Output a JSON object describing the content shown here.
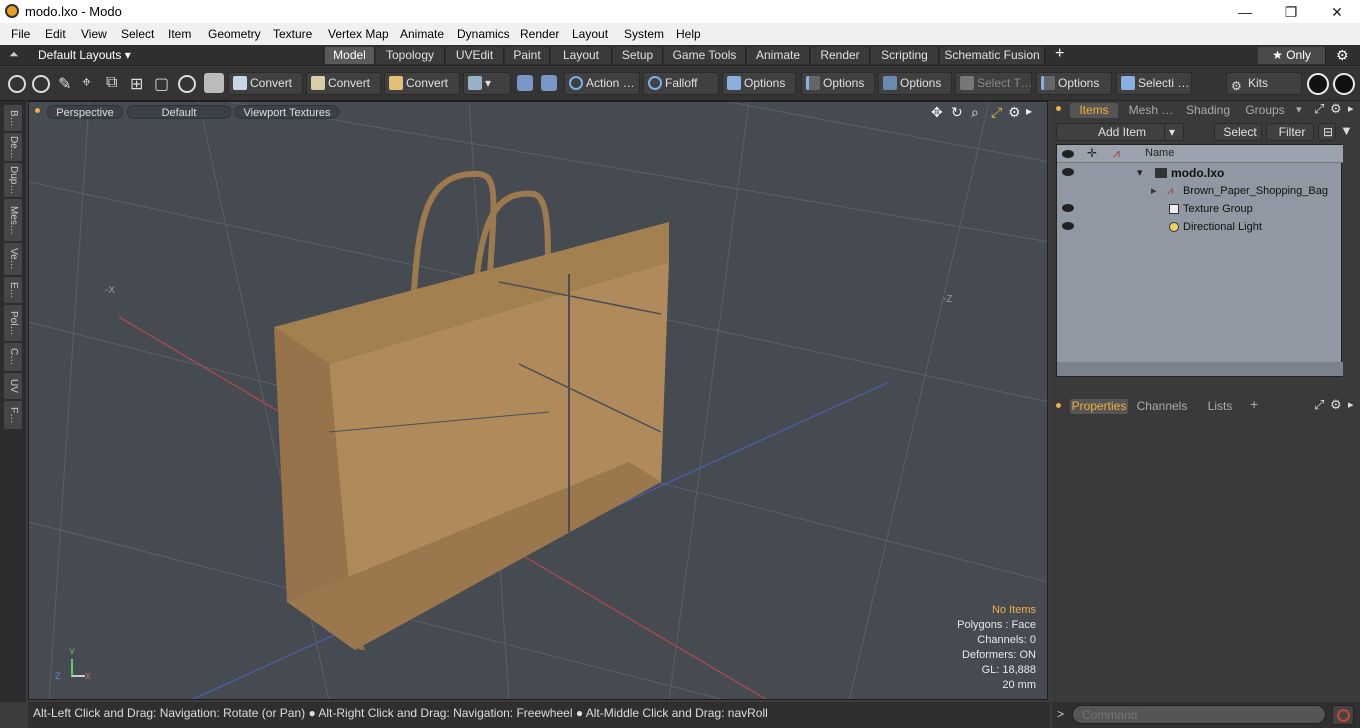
{
  "window": {
    "title": "modo.lxo - Modo",
    "minimize": "—",
    "maximize": "❐",
    "close": "✕"
  },
  "menu": [
    "File",
    "Edit",
    "View",
    "Select",
    "Item",
    "Geometry",
    "Texture",
    "Vertex Map",
    "Animate",
    "Dynamics",
    "Render",
    "Layout",
    "System",
    "Help"
  ],
  "layouts": {
    "dropdown": "Default Layouts ▾",
    "tabs": [
      "Model",
      "Topology",
      "UVEdit",
      "Paint",
      "Layout",
      "Setup",
      "Game Tools",
      "Animate",
      "Render",
      "Scripting",
      "Schematic Fusion"
    ],
    "active_tab": "Model",
    "add": "+",
    "only": "★ Only"
  },
  "toolbar": {
    "convert1": "Convert",
    "convert2": "Convert",
    "convert3": "Convert",
    "action": "Action …",
    "falloff": "Falloff",
    "options1": "Options",
    "options2": "Options",
    "options3": "Options",
    "options4": "Options",
    "select_t": "Select T…",
    "selecti": "Selecti …",
    "kits": "Kits"
  },
  "left_tabs": [
    "B…",
    "De…",
    "Dup…",
    "Mes…",
    "Ve…",
    "E…",
    "Pol…",
    "C…",
    "UV",
    "F…"
  ],
  "viewport": {
    "perspective": "Perspective",
    "default": "Default",
    "textures": "Viewport Textures",
    "axis_x": "-X",
    "axis_z": "-Z",
    "info": {
      "no_items": "No Items",
      "polygons": "Polygons : Face",
      "channels": "Channels: 0",
      "deformers": "Deformers: ON",
      "gl": "GL: 18,888",
      "mm": "20 mm"
    },
    "gizmo": {
      "y": "Y",
      "z": "Z",
      "x": "X"
    }
  },
  "items_panel": {
    "tabs": [
      "Items",
      "Mesh …",
      "Shading",
      "Groups"
    ],
    "add_item": "Add Item",
    "select": "Select",
    "filter": "Filter",
    "name_header": "Name",
    "rows": [
      "modo.lxo",
      "Brown_Paper_Shopping_Bag",
      "Texture Group",
      "Directional Light"
    ]
  },
  "props_panel": {
    "tabs": [
      "Properties",
      "Channels",
      "Lists"
    ],
    "add": "+"
  },
  "status": {
    "text": "Alt-Left Click and Drag: Navigation: Rotate (or Pan) ● Alt-Right Click and Drag: Navigation: Freewheel ● Alt-Middle Click and Drag: navRoll"
  },
  "command": {
    "placeholder": "Command",
    "prompt": ">"
  },
  "colors": {
    "accent": "#f0b040",
    "bag": "#b08a5a"
  }
}
